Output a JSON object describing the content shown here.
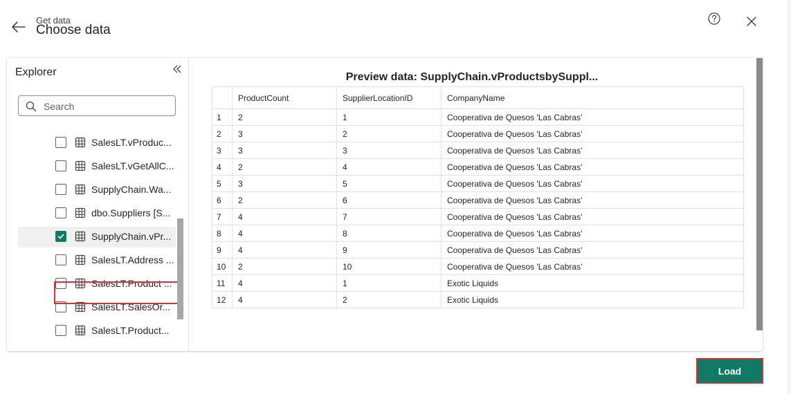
{
  "header": {
    "eyebrow": "Get data",
    "title": "Choose data",
    "icons": {
      "back": "arrow-left-icon",
      "help": "question-circle-icon",
      "close": "close-icon"
    }
  },
  "explorer": {
    "title": "Explorer",
    "collapse_icon": "double-chevron-left-icon",
    "search": {
      "placeholder": "Search",
      "value": ""
    },
    "items": [
      {
        "label": "SalesLT.vProduc...",
        "checked": false
      },
      {
        "label": "SalesLT.vGetAllC...",
        "checked": false
      },
      {
        "label": "SupplyChain.Wa...",
        "checked": false
      },
      {
        "label": "dbo.Suppliers [S...",
        "checked": false
      },
      {
        "label": "SupplyChain.vPr...",
        "checked": true
      },
      {
        "label": "SalesLT.Address ...",
        "checked": false
      },
      {
        "label": "SalesLT.Product ...",
        "checked": false
      },
      {
        "label": "SalesLT.SalesOr...",
        "checked": false
      },
      {
        "label": "SalesLT.Product...",
        "checked": false
      }
    ]
  },
  "preview": {
    "title": "Preview data: SupplyChain.vProductsbySuppl...",
    "columns": [
      "ProductCount",
      "SupplierLocationID",
      "CompanyName"
    ],
    "rows": [
      [
        "1",
        "2",
        "1",
        "Cooperativa de Quesos 'Las Cabras'"
      ],
      [
        "2",
        "3",
        "2",
        "Cooperativa de Quesos 'Las Cabras'"
      ],
      [
        "3",
        "3",
        "3",
        "Cooperativa de Quesos 'Las Cabras'"
      ],
      [
        "4",
        "2",
        "4",
        "Cooperativa de Quesos 'Las Cabras'"
      ],
      [
        "5",
        "3",
        "5",
        "Cooperativa de Quesos 'Las Cabras'"
      ],
      [
        "6",
        "2",
        "6",
        "Cooperativa de Quesos 'Las Cabras'"
      ],
      [
        "7",
        "4",
        "7",
        "Cooperativa de Quesos 'Las Cabras'"
      ],
      [
        "8",
        "4",
        "8",
        "Cooperativa de Quesos 'Las Cabras'"
      ],
      [
        "9",
        "4",
        "9",
        "Cooperativa de Quesos 'Las Cabras'"
      ],
      [
        "10",
        "2",
        "10",
        "Cooperativa de Quesos 'Las Cabras'"
      ],
      [
        "11",
        "4",
        "1",
        "Exotic Liquids"
      ],
      [
        "12",
        "4",
        "2",
        "Exotic Liquids"
      ]
    ]
  },
  "footer": {
    "load_label": "Load"
  },
  "colors": {
    "accent": "#117865",
    "highlight": "#d13438"
  }
}
